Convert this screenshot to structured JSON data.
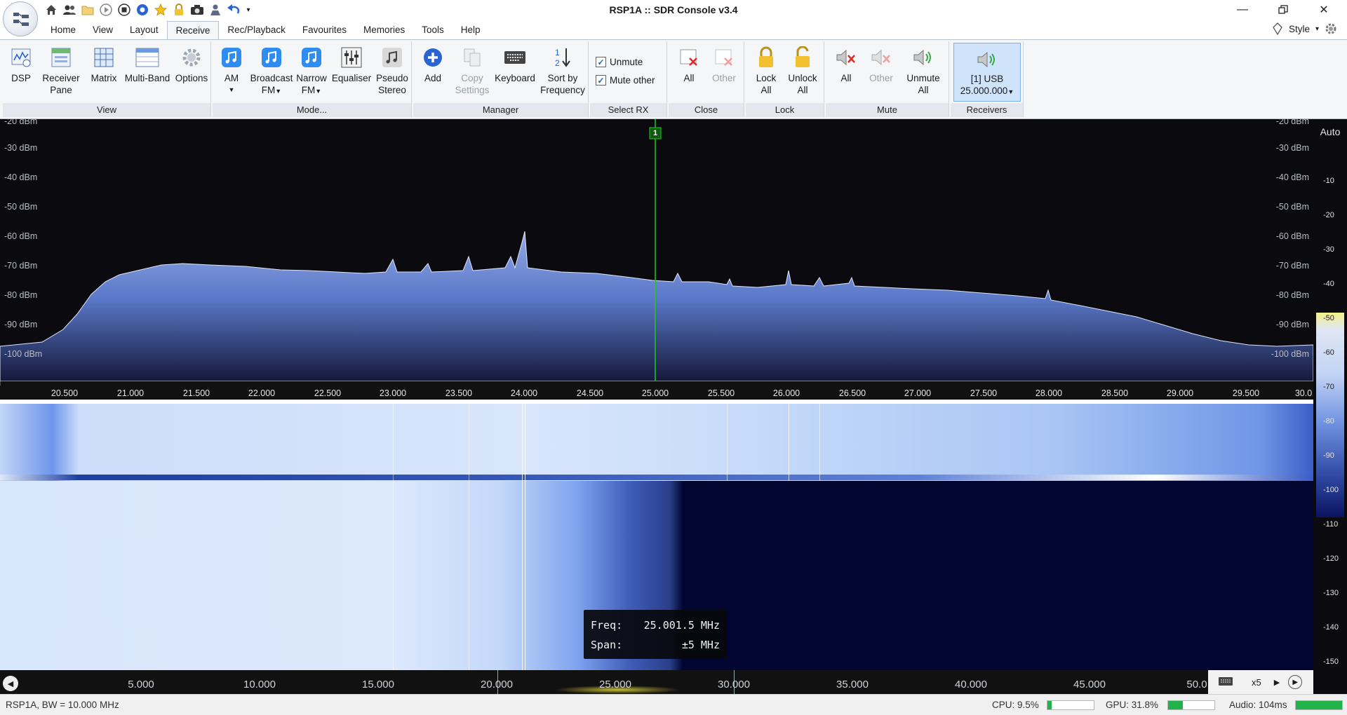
{
  "window": {
    "title": "RSP1A :: SDR Console v3.4"
  },
  "qat_icons": [
    "home-icon",
    "users-icon",
    "folder-icon",
    "play-icon",
    "stop-icon",
    "record-icon",
    "star-icon",
    "lock-icon",
    "camera-icon",
    "user-icon",
    "undo-icon",
    "dropdown-icon"
  ],
  "tabs": [
    "Home",
    "View",
    "Layout",
    "Receive",
    "Rec/Playback",
    "Favourites",
    "Memories",
    "Tools",
    "Help"
  ],
  "active_tab": "Receive",
  "style_menu": "Style",
  "ribbon": {
    "view": {
      "title": "View",
      "dsp": "DSP",
      "receiver_pane_1": "Receiver",
      "receiver_pane_2": "Pane",
      "matrix": "Matrix",
      "multiband": "Multi-Band",
      "options": "Options"
    },
    "mode": {
      "title": "Mode...",
      "am": "AM",
      "bfm_1": "Broadcast",
      "bfm_2": "FM",
      "nfm_1": "Narrow",
      "nfm_2": "FM",
      "equaliser": "Equaliser",
      "pseudo_1": "Pseudo",
      "pseudo_2": "Stereo"
    },
    "manager": {
      "title": "Manager",
      "add": "Add",
      "copy_1": "Copy",
      "copy_2": "Settings",
      "keyboard": "Keyboard",
      "sort_1": "Sort by",
      "sort_2": "Frequency"
    },
    "select_rx": {
      "title": "Select RX",
      "unmute": "Unmute",
      "mute_other": "Mute other"
    },
    "close": {
      "title": "Close",
      "all": "All",
      "other": "Other"
    },
    "lock": {
      "title": "Lock",
      "lock_1": "Lock",
      "lock_2": "All",
      "unlock_1": "Unlock",
      "unlock_2": "All"
    },
    "mute": {
      "title": "Mute",
      "all": "All",
      "other": "Other",
      "unmute_1": "Unmute",
      "unmute_2": "All"
    },
    "receivers": {
      "title": "Receivers",
      "line1": "[1]  USB",
      "line2": "25.000.000"
    }
  },
  "spectrum": {
    "dbm_labels": [
      "-20 dBm",
      "-30 dBm",
      "-40 dBm",
      "-50 dBm",
      "-60 dBm",
      "-70 dBm",
      "-80 dBm",
      "-90 dBm",
      "-100 dBm"
    ],
    "marker_label": "1",
    "freq_labels": [
      "20.500",
      "21.000",
      "21.500",
      "22.000",
      "22.500",
      "23.000",
      "23.500",
      "24.000",
      "24.500",
      "25.000",
      "25.500",
      "26.000",
      "26.500",
      "27.000",
      "27.500",
      "28.000",
      "28.500",
      "29.000",
      "29.500",
      "30.0"
    ]
  },
  "tooltip": {
    "freq_label": "Freq:",
    "freq_value": "25.001.5 MHz",
    "span_label": "Span:",
    "span_value": "±5 MHz"
  },
  "overview": {
    "labels": [
      "5.000",
      "10.000",
      "15.000",
      "20.000",
      "25.000",
      "30.000",
      "35.000",
      "40.000",
      "45.000",
      "50.0"
    ],
    "zoom": "x5"
  },
  "right_scale": {
    "auto": "Auto",
    "labels": [
      "-10",
      "-20",
      "-30",
      "-40",
      "-50",
      "-60",
      "-70",
      "-80",
      "-90",
      "-100",
      "-110",
      "-120",
      "-130",
      "-140",
      "-150"
    ]
  },
  "status": {
    "device": "RSP1A, BW = 10.000 MHz",
    "cpu": "CPU: 9.5%",
    "cpu_level": 0.095,
    "gpu": "GPU: 31.8%",
    "gpu_level": 0.318,
    "audio": "Audio: 104ms",
    "audio_level": 1.0
  },
  "colors": {
    "marker": "#1ec81e",
    "spectrum_fill": "#5a78c8",
    "waterfall_dark": "#020530",
    "meter": "#22b24c"
  }
}
